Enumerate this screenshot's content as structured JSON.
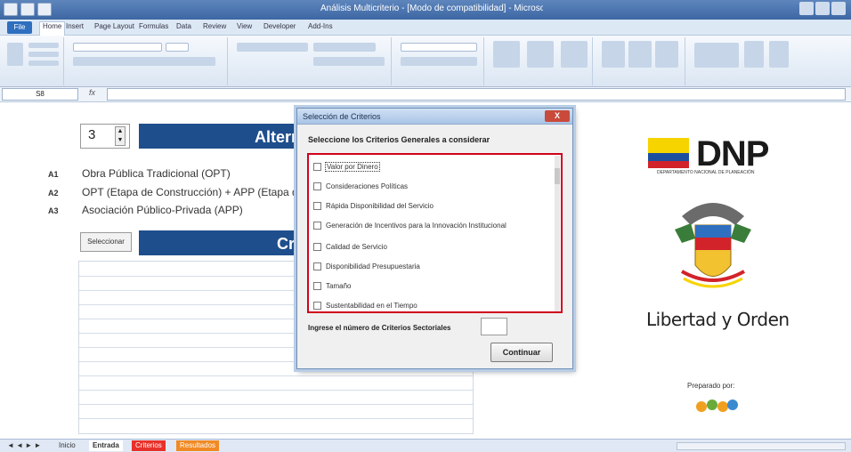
{
  "window": {
    "title": "Análisis Multicriterio - [Modo de compatibilidad] - Microsoft Excel no comercial"
  },
  "ribbon": {
    "file_tab": "File",
    "tabs": [
      "Home",
      "Insert",
      "Page Layout",
      "Formulas",
      "Data",
      "Review",
      "View",
      "Developer",
      "Add-Ins"
    ],
    "active_tab": "Home"
  },
  "formula_bar": {
    "name_box": "S8",
    "fx": "fx"
  },
  "sheet": {
    "spinner_value": "3",
    "alternativas_header": "Alternativas",
    "criterios_header": "Criterios",
    "alternatives": [
      {
        "code": "A1",
        "text": "Obra Pública Tradicional (OPT)"
      },
      {
        "code": "A2",
        "text": "OPT (Etapa de Construcción) + APP (Etapa de Operación)"
      },
      {
        "code": "A3",
        "text": "Asociación Público-Privada (APP)"
      }
    ],
    "select_button": "Seleccionar"
  },
  "logo": {
    "dnp": "DNP",
    "dnp_subtitle": "DEPARTAMENTO NACIONAL DE PLANEACIÓN",
    "motto": "Libertad y Orden",
    "prepared_by": "Preparado por:"
  },
  "dialog": {
    "title": "Selección de Criterios",
    "close": "X",
    "heading": "Seleccione los Criterios Generales a considerar",
    "criteria": [
      "Valor por Dinero",
      "Consideraciones Políticas",
      "Rápida Disponibilidad del Servicio",
      "Generación de Incentivos para la Innovación Institucional",
      "Calidad de Servicio",
      "Disponibilidad Presupuestaria",
      "Tamaño",
      "Sustentabilidad en el Tiempo"
    ],
    "sector_label": "Ingrese el número de Criterios Sectoriales",
    "sector_value": "",
    "continue_button": "Continuar"
  },
  "sheet_tabs": {
    "nav": "◄ ◄ ► ►",
    "tabs": [
      "Inicio",
      "Entrada",
      "Criterios",
      "Resultados"
    ],
    "active": "Entrada"
  },
  "colors": {
    "header_blue": "#1f4e8c",
    "highlight_red": "#d0021b",
    "tab_red": "#e8312a",
    "tab_orange": "#f08a24"
  }
}
